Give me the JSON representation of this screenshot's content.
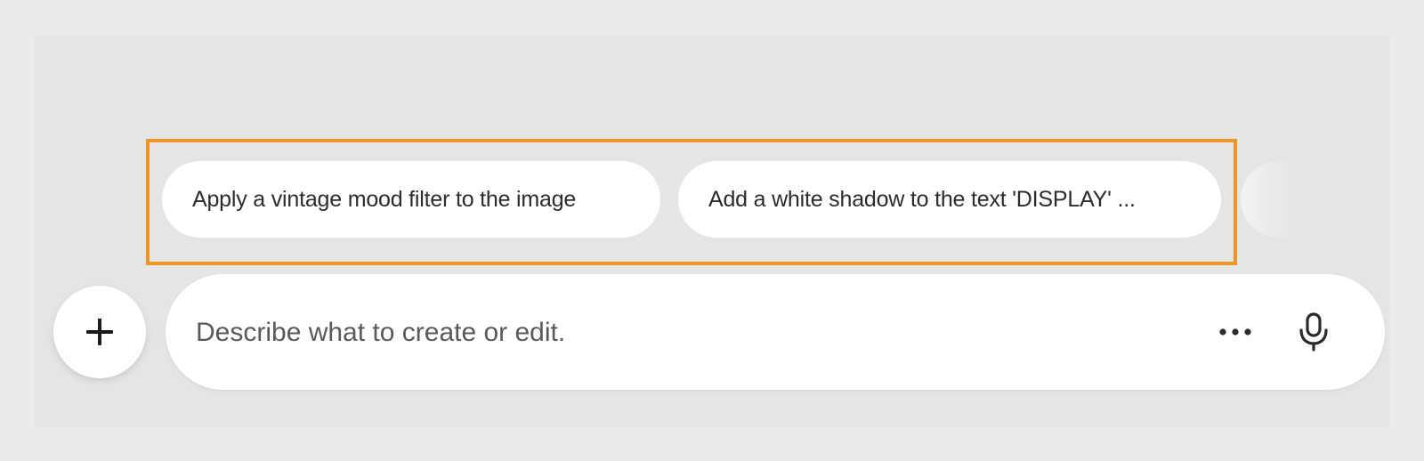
{
  "suggestions": {
    "items": [
      {
        "label": "Apply a vintage mood filter to the image"
      },
      {
        "label": "Add a white shadow to the text 'DISPLAY' ..."
      }
    ]
  },
  "composer": {
    "placeholder": "Describe what to create or edit.",
    "add_icon": "plus-icon",
    "more_icon": "more-horizontal-icon",
    "mic_icon": "microphone-icon"
  },
  "colors": {
    "highlight_border": "#ee9527",
    "panel_background": "#e5e5e5",
    "page_background": "#ebebeb",
    "surface": "#ffffff",
    "text": "#2c2c2c"
  }
}
